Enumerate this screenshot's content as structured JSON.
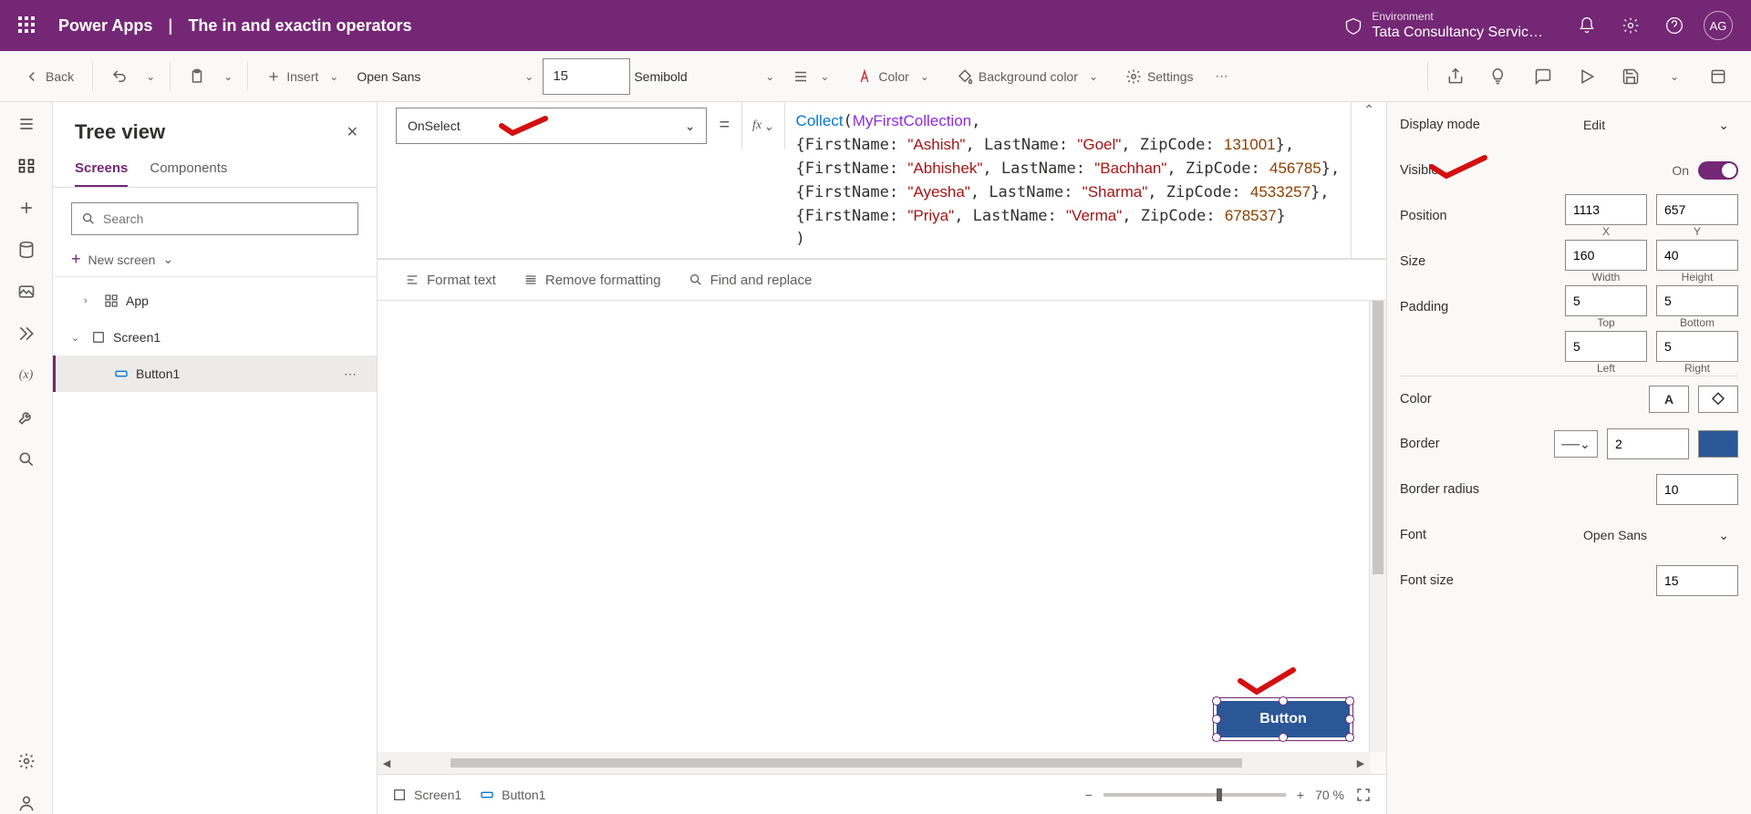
{
  "header": {
    "product": "Power Apps",
    "page_title": "The in and exactin operators",
    "separator": "|",
    "env_label": "Environment",
    "env_name": "Tata Consultancy Servic…",
    "avatar": "AG"
  },
  "cmdbar": {
    "back": "Back",
    "insert": "Insert",
    "font": "Open Sans",
    "font_size": "15",
    "font_weight": "Semibold",
    "color_label": "Color",
    "bg_label": "Background color",
    "settings": "Settings"
  },
  "formula": {
    "property": "OnSelect",
    "fx": "fx",
    "tools": {
      "format": "Format text",
      "remove": "Remove formatting",
      "find": "Find and replace"
    },
    "code_records": [
      {
        "fn": "Collect",
        "coll": "MyFirstCollection"
      },
      {
        "first": "\"Ashish\"",
        "last": "\"Goel\"",
        "zip": "131001"
      },
      {
        "first": "\"Abhishek\"",
        "last": "\"Bachhan\"",
        "zip": "456785"
      },
      {
        "first": "\"Ayesha\"",
        "last": "\"Sharma\"",
        "zip": "4533257"
      },
      {
        "first": "\"Priya\"",
        "last": "\"Verma\"",
        "zip": "678537"
      }
    ]
  },
  "tree": {
    "title": "Tree view",
    "tabs": {
      "screens": "Screens",
      "components": "Components"
    },
    "search_placeholder": "Search",
    "new_screen": "New screen",
    "app": "App",
    "screen1": "Screen1",
    "button1": "Button1"
  },
  "canvas": {
    "button_text": "Button"
  },
  "status": {
    "screen": "Screen1",
    "control": "Button1",
    "zoom": "70",
    "zoom_suffix": "%"
  },
  "props": {
    "display_mode_label": "Display mode",
    "display_mode": "Edit",
    "visible_label": "Visible",
    "visible_value": "On",
    "position_label": "Position",
    "pos_x": "1113",
    "pos_y": "657",
    "pos_x_lbl": "X",
    "pos_y_lbl": "Y",
    "size_label": "Size",
    "size_w": "160",
    "size_h": "40",
    "size_w_lbl": "Width",
    "size_h_lbl": "Height",
    "padding_label": "Padding",
    "pad_top": "5",
    "pad_bottom": "5",
    "pad_left": "5",
    "pad_right": "5",
    "pad_top_lbl": "Top",
    "pad_bottom_lbl": "Bottom",
    "pad_left_lbl": "Left",
    "pad_right_lbl": "Right",
    "color_label": "Color",
    "border_label": "Border",
    "border_width": "2",
    "border_radius_label": "Border radius",
    "border_radius": "10",
    "font_label": "Font",
    "font": "Open Sans",
    "font_size_label": "Font size",
    "font_size": "15"
  }
}
